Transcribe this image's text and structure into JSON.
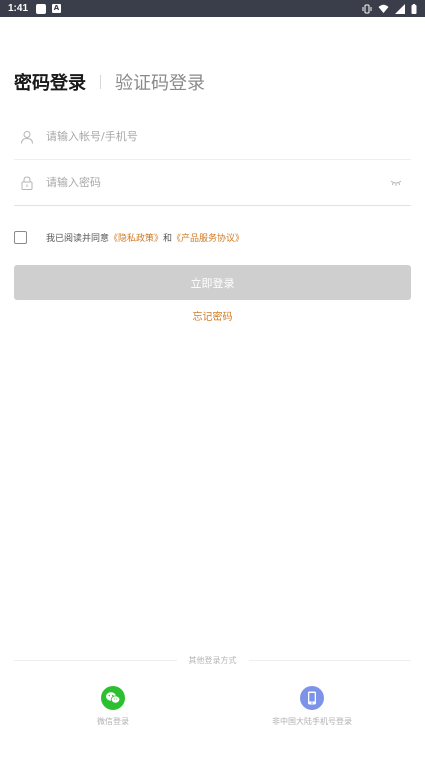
{
  "status_bar": {
    "time": "1:41"
  },
  "tabs": {
    "password_login": "密码登录",
    "code_login": "验证码登录"
  },
  "form": {
    "account_placeholder": "请输入帐号/手机号",
    "password_placeholder": "请输入密码"
  },
  "agreement": {
    "prefix": "我已阅读并同意",
    "privacy_link": "《隐私政策》",
    "and": "和",
    "service_link": "《产品服务协议》"
  },
  "login_button": "立即登录",
  "forgot_password": "忘记密码",
  "other_methods": {
    "title": "其他登录方式",
    "wechat_label": "微信登录",
    "phone_label": "非中国大陆手机号登录"
  },
  "colors": {
    "accent": "#d17a24",
    "wechat": "#2cbf2f",
    "phone": "#7d93e8",
    "button_disabled": "#cfcfcf"
  },
  "icons": [
    "user-icon",
    "lock-icon",
    "eye-closed-icon",
    "wechat-icon",
    "mobile-phone-icon"
  ]
}
